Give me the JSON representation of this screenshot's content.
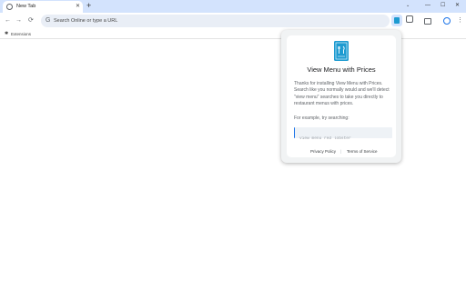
{
  "browser": {
    "tab": {
      "title": "New Tab",
      "close": "✕"
    },
    "new_tab_glyph": "+",
    "window_controls": {
      "down": "⌄",
      "minimize": "—",
      "maximize": "☐",
      "close": "✕"
    },
    "nav": {
      "back": "←",
      "forward": "→",
      "reload": "⟳"
    },
    "omnibox": {
      "placeholder": "Search Online or type a URL",
      "icon": "G"
    },
    "menu_glyph": "⋮",
    "bookmarks": {
      "icon": "✱",
      "label": "Extensions"
    },
    "accent_color": "#1a73e8",
    "tabstrip_color": "#d3e3fd"
  },
  "popup": {
    "logo_icon": "menu-book-icon",
    "logo_color": "#1d9bd1",
    "title": "View Menu with Prices",
    "body": "Thanks for installing View Menu with Prices. Search like you normally would and we'll detect \"view menu\" searches to take you directly to restaurant menus with prices.",
    "example_label": "For example, try searching:",
    "search_placeholder": "view menu red lobster",
    "links": {
      "privacy": "Privacy Policy",
      "separator": "|",
      "terms": "Terms of Service"
    }
  }
}
